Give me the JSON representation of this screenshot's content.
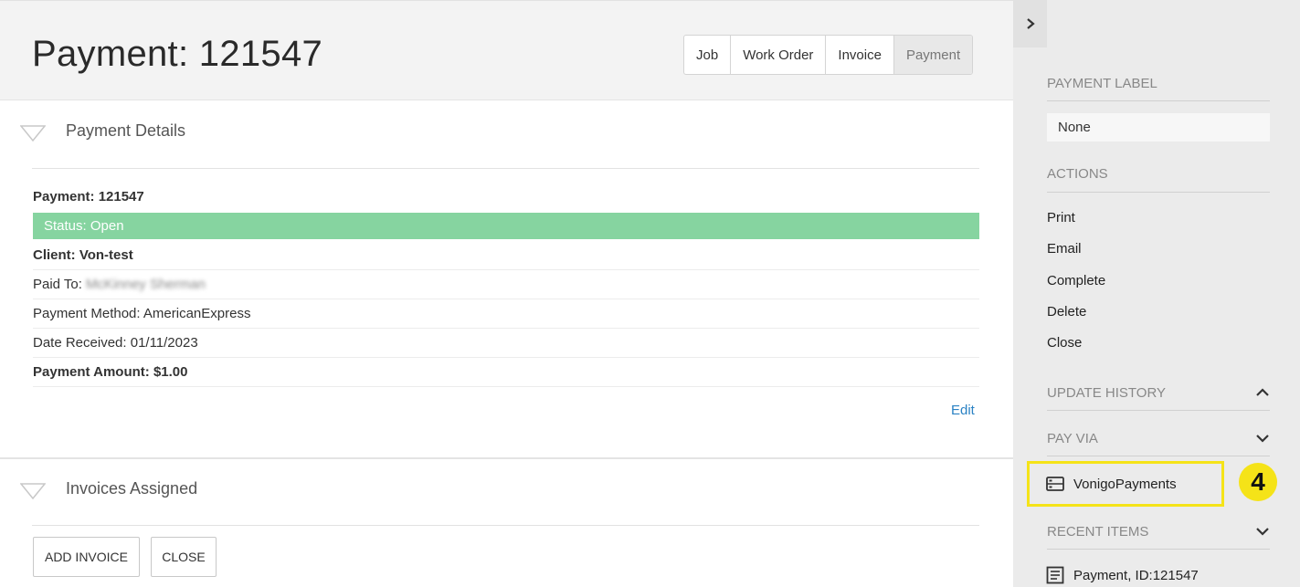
{
  "header": {
    "title": "Payment: 121547",
    "tabs": [
      {
        "label": "Job",
        "active": false
      },
      {
        "label": "Work Order",
        "active": false
      },
      {
        "label": "Invoice",
        "active": false
      },
      {
        "label": "Payment",
        "active": true
      }
    ]
  },
  "payment_details": {
    "section_title": "Payment Details",
    "payment_line": "Payment: 121547",
    "status": "Status: Open",
    "client": "Client: Von-test",
    "paid_to_label": "Paid To:",
    "paid_to_value": "McKinney Sherman",
    "payment_method": "Payment Method: AmericanExpress",
    "date_received": "Date Received: 01/11/2023",
    "payment_amount": "Payment Amount: $1.00",
    "edit_label": "Edit"
  },
  "invoices_assigned": {
    "section_title": "Invoices Assigned",
    "add_invoice_label": "ADD INVOICE",
    "close_label": "CLOSE"
  },
  "sidebar": {
    "payment_label_heading": "PAYMENT LABEL",
    "payment_label_value": "None",
    "actions_heading": "ACTIONS",
    "actions": [
      "Print",
      "Email",
      "Complete",
      "Delete",
      "Close"
    ],
    "update_history_heading": "UPDATE HISTORY",
    "pay_via_heading": "PAY VIA",
    "pay_via_option": "VonigoPayments",
    "step_badge": "4",
    "recent_items_heading": "RECENT ITEMS",
    "recent_item": "Payment, ID:121547"
  },
  "colors": {
    "status_open": "#86d4a0",
    "link": "#2a82c4",
    "highlight": "#f5e318"
  },
  "icons": [
    "chevron-right-icon",
    "triangle-down-icon",
    "chevron-up-icon",
    "chevron-down-icon",
    "card-reader-icon",
    "document-icon"
  ]
}
